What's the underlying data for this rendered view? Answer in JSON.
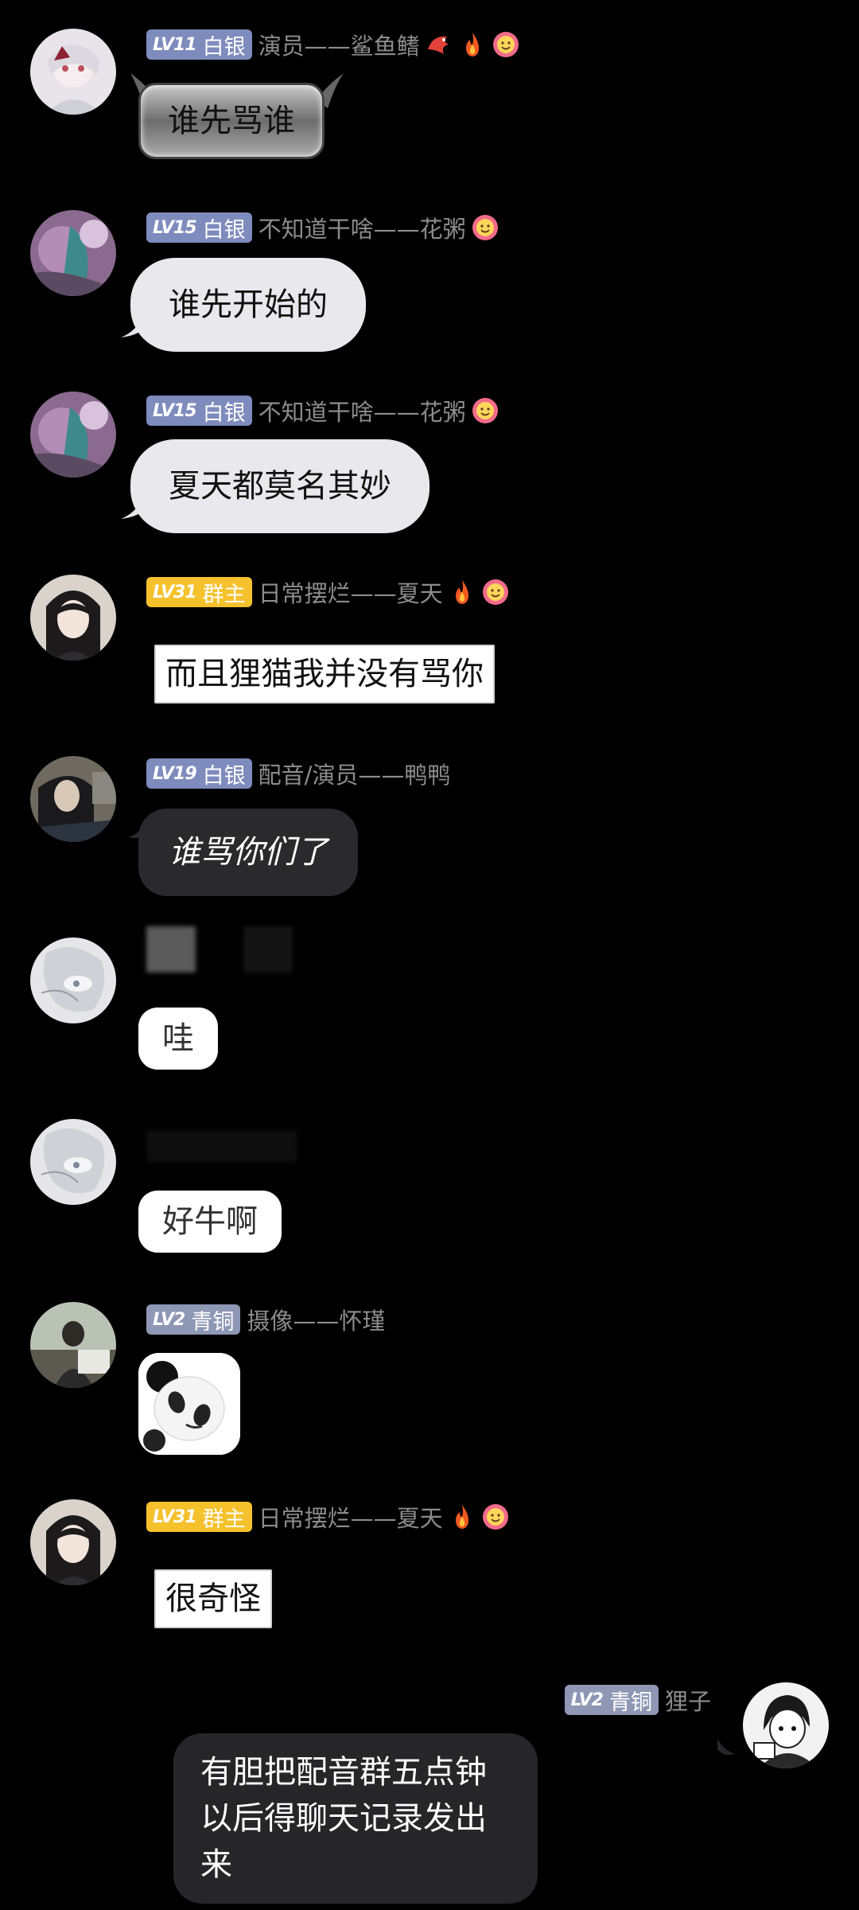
{
  "messages": [
    {
      "level": "LV11",
      "rank": "白银",
      "role": "演员——鲨鱼鳍",
      "text": "谁先骂谁",
      "icons": [
        "dragon-icon",
        "fire-icon",
        "flower-face-icon"
      ]
    },
    {
      "level": "LV15",
      "rank": "白银",
      "role": "不知道干啥——花粥",
      "text": "谁先开始的",
      "icons": [
        "flower-face-icon"
      ]
    },
    {
      "level": "LV15",
      "rank": "白银",
      "role": "不知道干啥——花粥",
      "text": "夏天都莫名其妙",
      "icons": [
        "flower-face-icon"
      ]
    },
    {
      "level": "LV31",
      "rank": "群主",
      "role": "日常摆烂——夏天",
      "text": "而且狸猫我并没有骂你",
      "icons": [
        "fire-icon",
        "flower-face-icon"
      ]
    },
    {
      "level": "LV19",
      "rank": "白银",
      "role": "配音/演员——鸭鸭",
      "text": "谁骂你们了"
    },
    {
      "text": "哇"
    },
    {
      "text": "好牛啊"
    },
    {
      "level": "LV2",
      "rank": "青铜",
      "role": "摄像——怀瑾",
      "sticker": "panda-meme-sticker"
    },
    {
      "level": "LV31",
      "rank": "群主",
      "role": "日常摆烂——夏天",
      "text": "很奇怪",
      "icons": [
        "fire-icon",
        "flower-face-icon"
      ]
    }
  ],
  "self_message": {
    "level": "LV2",
    "rank": "青铜",
    "name": "狸子",
    "text": "有胆把配音群五点钟以后得聊天记录发出来"
  },
  "colors": {
    "background": "#000000",
    "silver_badge": "#7e8bbd",
    "gold_badge": "#f5c12c",
    "bronze_badge": "#8e97b4",
    "light_bubble": "#e9e9ed",
    "dark_bubble": "#2a2a2c"
  }
}
